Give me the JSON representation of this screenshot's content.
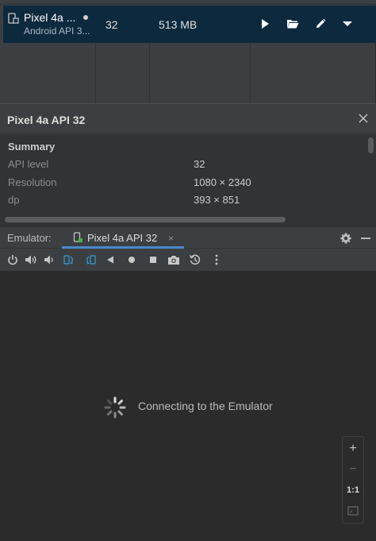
{
  "device_row": {
    "name": "Pixel 4a ...",
    "subtitle": "Android API 3...",
    "api": "32",
    "size": "513 MB"
  },
  "details": {
    "title": "Pixel 4a API 32",
    "summary_heading": "Summary",
    "rows": [
      {
        "label": "API level",
        "value": "32"
      },
      {
        "label": "Resolution",
        "value": "1080 × 2340"
      },
      {
        "label": "dp",
        "value": "393 × 851"
      }
    ]
  },
  "emulator": {
    "label": "Emulator:",
    "tab_label": "Pixel 4a API 32",
    "tab_close": "×",
    "status": "Connecting to the Emulator",
    "zoom": {
      "plus": "+",
      "minus": "−",
      "actual": "1:1"
    }
  },
  "colors": {
    "selected_row": "#0d293e",
    "accent": "#4a88c7",
    "rotate_icon": "#3592c4"
  },
  "icons": {
    "device_row_actions": [
      "play-icon",
      "folder-open-icon",
      "pencil-icon",
      "caret-down-icon"
    ],
    "toolbar": [
      "power-icon",
      "volume-up-icon",
      "volume-down-icon",
      "rotate-left-icon",
      "rotate-right-icon",
      "back-icon",
      "home-icon",
      "overview-icon",
      "camera-icon",
      "snapshot-icon",
      "more-vert-icon"
    ]
  }
}
